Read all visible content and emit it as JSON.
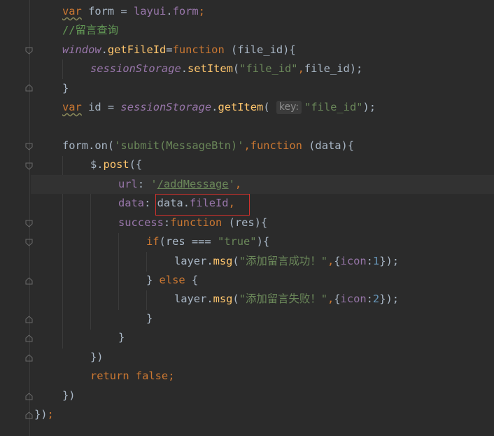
{
  "editor": {
    "lines": [
      [
        {
          "t": "var",
          "c": "kw wavy"
        },
        {
          "t": " form = ",
          "c": "plain"
        },
        {
          "t": "layui",
          "c": "var"
        },
        {
          "t": ".",
          "c": "plain"
        },
        {
          "t": "form",
          "c": "var"
        },
        {
          "t": ";",
          "c": "kw"
        }
      ],
      [
        {
          "t": "//留言查询",
          "c": "cmt cjk-mix"
        }
      ],
      [
        {
          "t": "window",
          "c": "ivar"
        },
        {
          "t": ".",
          "c": "plain"
        },
        {
          "t": "getFileId",
          "c": "fn"
        },
        {
          "t": "=",
          "c": "plain"
        },
        {
          "t": "function",
          "c": "kw"
        },
        {
          "t": " (file_id){",
          "c": "plain"
        }
      ],
      [
        {
          "t": "sessionStorage",
          "c": "ivar"
        },
        {
          "t": ".",
          "c": "plain"
        },
        {
          "t": "setItem",
          "c": "fn"
        },
        {
          "t": "(",
          "c": "plain"
        },
        {
          "t": "\"file_id\"",
          "c": "str"
        },
        {
          "t": ",",
          "c": "kw"
        },
        {
          "t": "file_id);",
          "c": "plain"
        }
      ],
      [
        {
          "t": "}",
          "c": "plain"
        }
      ],
      [
        {
          "t": "var",
          "c": "kw wavy"
        },
        {
          "t": " id = ",
          "c": "plain"
        },
        {
          "t": "sessionStorage",
          "c": "ivar"
        },
        {
          "t": ".",
          "c": "plain"
        },
        {
          "t": "getItem",
          "c": "fn"
        },
        {
          "t": "( ",
          "c": "plain"
        },
        {
          "t": "key:",
          "c": "hint"
        },
        {
          "t": "\"file_id\"",
          "c": "str"
        },
        {
          "t": ");",
          "c": "plain"
        }
      ],
      [],
      [
        {
          "t": "form.on(",
          "c": "plain"
        },
        {
          "t": "'submit(MessageBtn)'",
          "c": "str"
        },
        {
          "t": ",",
          "c": "kw"
        },
        {
          "t": "function",
          "c": "kw"
        },
        {
          "t": " (data){",
          "c": "plain"
        }
      ],
      [
        {
          "t": "$.",
          "c": "plain"
        },
        {
          "t": "post",
          "c": "fn"
        },
        {
          "t": "({",
          "c": "plain"
        }
      ],
      [
        {
          "t": "url",
          "c": "var"
        },
        {
          "t": ": ",
          "c": "plain"
        },
        {
          "t": "'",
          "c": "str"
        },
        {
          "t": "/addMessage",
          "c": "url"
        },
        {
          "t": "'",
          "c": "str"
        },
        {
          "t": ",",
          "c": "kw"
        }
      ],
      [
        {
          "t": "data",
          "c": "var"
        },
        {
          "t": ": ",
          "c": "plain"
        },
        {
          "t": "data.",
          "c": "plain"
        },
        {
          "t": "fileId",
          "c": "var"
        },
        {
          "t": ",",
          "c": "kw"
        }
      ],
      [
        {
          "t": "success",
          "c": "var"
        },
        {
          "t": ":",
          "c": "plain"
        },
        {
          "t": "function",
          "c": "kw"
        },
        {
          "t": " (res){",
          "c": "plain"
        }
      ],
      [
        {
          "t": "if",
          "c": "kw"
        },
        {
          "t": "(res === ",
          "c": "plain"
        },
        {
          "t": "\"true\"",
          "c": "str"
        },
        {
          "t": "){",
          "c": "plain"
        }
      ],
      [
        {
          "t": "layer.",
          "c": "plain"
        },
        {
          "t": "msg",
          "c": "fn"
        },
        {
          "t": "(",
          "c": "plain"
        },
        {
          "t": "\"添加留言成功！\"",
          "c": "str"
        },
        {
          "t": ",",
          "c": "kw"
        },
        {
          "t": "{",
          "c": "plain"
        },
        {
          "t": "icon",
          "c": "var"
        },
        {
          "t": ":",
          "c": "plain"
        },
        {
          "t": "1",
          "c": "num"
        },
        {
          "t": "});",
          "c": "plain"
        }
      ],
      [
        {
          "t": "} ",
          "c": "plain"
        },
        {
          "t": "else",
          "c": "kw"
        },
        {
          "t": " {",
          "c": "plain"
        }
      ],
      [
        {
          "t": "layer.",
          "c": "plain"
        },
        {
          "t": "msg",
          "c": "fn"
        },
        {
          "t": "(",
          "c": "plain"
        },
        {
          "t": "\"添加留言失败！\"",
          "c": "str"
        },
        {
          "t": ",",
          "c": "kw"
        },
        {
          "t": "{",
          "c": "plain"
        },
        {
          "t": "icon",
          "c": "var"
        },
        {
          "t": ":",
          "c": "plain"
        },
        {
          "t": "2",
          "c": "num"
        },
        {
          "t": "});",
          "c": "plain"
        }
      ],
      [
        {
          "t": "}",
          "c": "plain"
        }
      ],
      [
        {
          "t": "}",
          "c": "plain"
        }
      ],
      [
        {
          "t": "})",
          "c": "plain"
        }
      ],
      [
        {
          "t": "return false",
          "c": "kw"
        },
        {
          "t": ";",
          "c": "kw"
        }
      ],
      [
        {
          "t": "})",
          "c": "plain"
        }
      ],
      [
        {
          "t": "})",
          "c": "plain"
        },
        {
          "t": ";",
          "c": "kw"
        }
      ]
    ]
  }
}
